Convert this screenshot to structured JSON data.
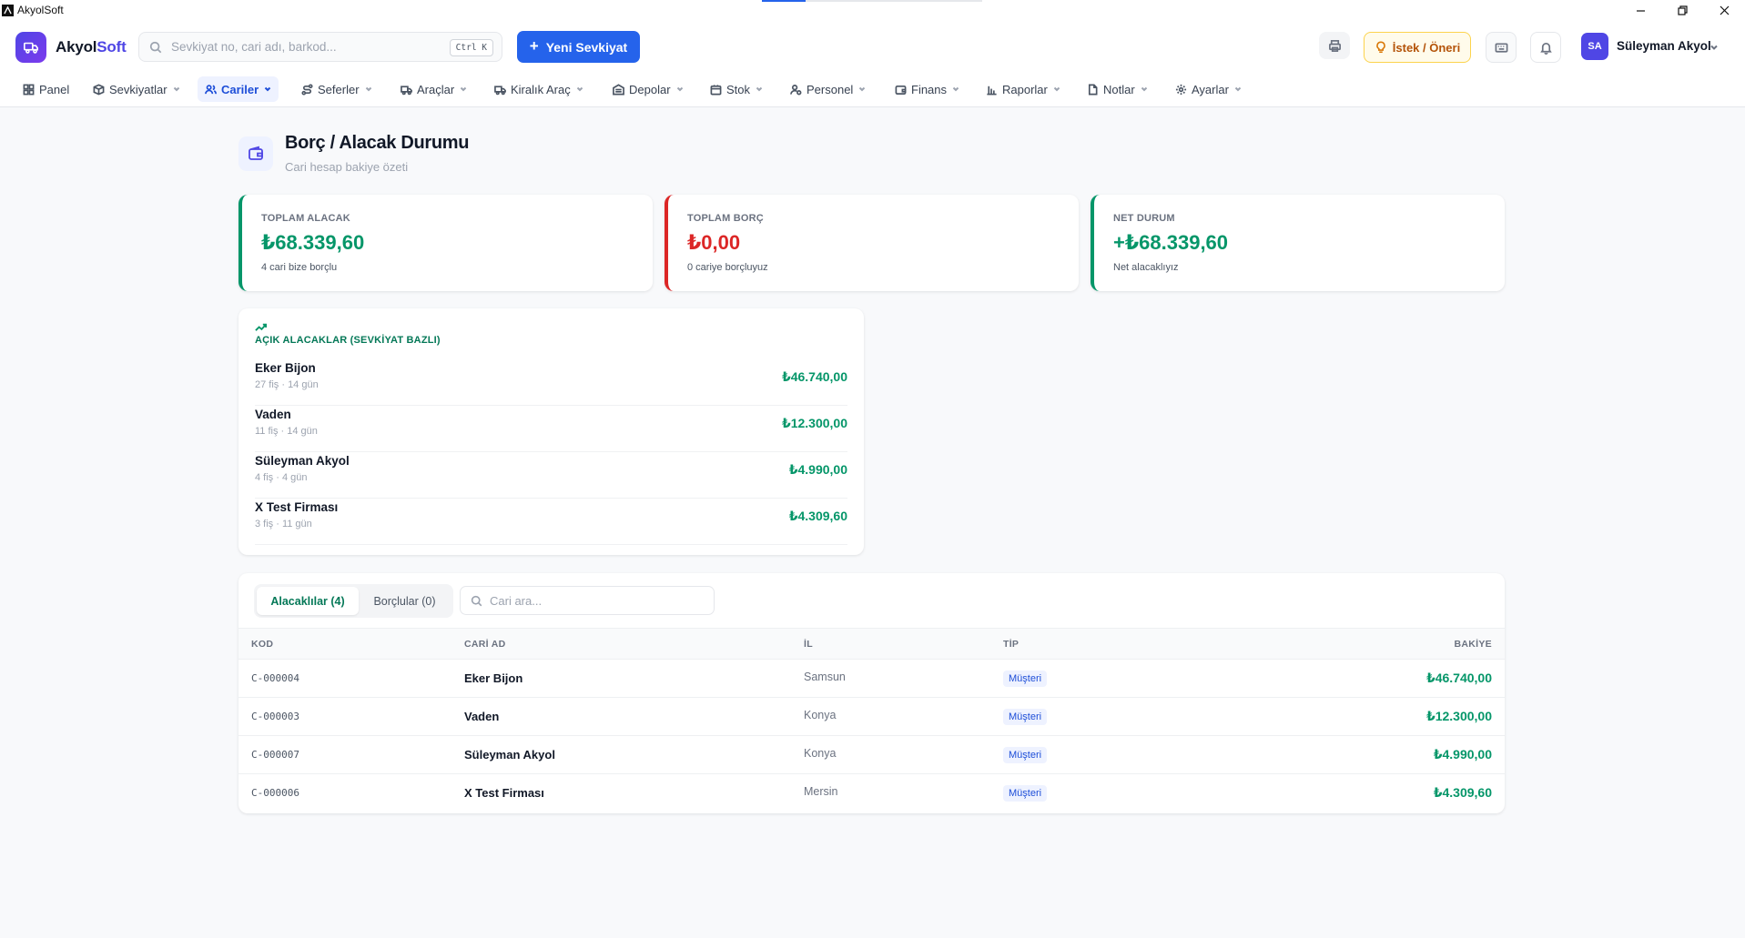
{
  "window": {
    "title": "AkyolSoft"
  },
  "header": {
    "brand_main": "Akyol",
    "brand_accent": "Soft",
    "search_placeholder": "Sevkiyat no, cari adı, barkod...",
    "search_shortcut": "Ctrl K",
    "new_button": "Yeni Sevkiyat",
    "suggest_button": "İstek / Öneri",
    "user_initials": "SA",
    "user_name": "Süleyman Akyol"
  },
  "nav": {
    "items": [
      {
        "label": "Panel",
        "icon": "grid-icon"
      },
      {
        "label": "Sevkiyatlar",
        "icon": "box-icon"
      },
      {
        "label": "Cariler",
        "icon": "users-icon",
        "active": true
      },
      {
        "label": "Seferler",
        "icon": "route-icon"
      },
      {
        "label": "Araçlar",
        "icon": "truck-icon"
      },
      {
        "label": "Kiralık Araç",
        "icon": "truck-icon"
      },
      {
        "label": "Depolar",
        "icon": "warehouse-icon"
      },
      {
        "label": "Stok",
        "icon": "package-icon"
      },
      {
        "label": "Personel",
        "icon": "user-cog-icon"
      },
      {
        "label": "Finans",
        "icon": "wallet-icon"
      },
      {
        "label": "Raporlar",
        "icon": "bar-chart-icon"
      },
      {
        "label": "Notlar",
        "icon": "file-icon"
      },
      {
        "label": "Ayarlar",
        "icon": "gear-icon"
      }
    ]
  },
  "page": {
    "title": "Borç / Alacak Durumu",
    "subtitle": "Cari hesap bakiye özeti"
  },
  "summary": [
    {
      "label": "TOPLAM ALACAK",
      "value": "₺68.339,60",
      "note": "4 cari bize borçlu",
      "color": "#059669"
    },
    {
      "label": "TOPLAM BORÇ",
      "value": "₺0,00",
      "note": "0 cariye borçluyuz",
      "color": "#dc2626"
    },
    {
      "label": "NET DURUM",
      "value": "+₺68.339,60",
      "note": "Net alacaklıyız",
      "color": "#059669"
    }
  ],
  "open_receivables": {
    "title": "AÇIK ALACAKLAR (SEVKİYAT BAZLI)",
    "items": [
      {
        "name": "Eker Bijon",
        "meta": "27 fiş · 14 gün",
        "amount": "₺46.740,00"
      },
      {
        "name": "Vaden",
        "meta": "11 fiş · 14 gün",
        "amount": "₺12.300,00"
      },
      {
        "name": "Süleyman Akyol",
        "meta": "4 fiş · 4 gün",
        "amount": "₺4.990,00"
      },
      {
        "name": "X Test Firması",
        "meta": "3 fiş · 11 gün",
        "amount": "₺4.309,60"
      }
    ]
  },
  "table": {
    "tabs": [
      "Alacaklılar (4)",
      "Borçlular (0)"
    ],
    "search_placeholder": "Cari ara...",
    "columns": [
      "KOD",
      "CARİ AD",
      "İL",
      "TİP",
      "BAKİYE"
    ],
    "rows": [
      {
        "code": "C-000004",
        "name": "Eker Bijon",
        "city": "Samsun",
        "type": "Müşteri",
        "balance": "₺46.740,00"
      },
      {
        "code": "C-000003",
        "name": "Vaden",
        "city": "Konya",
        "type": "Müşteri",
        "balance": "₺12.300,00"
      },
      {
        "code": "C-000007",
        "name": "Süleyman Akyol",
        "city": "Konya",
        "type": "Müşteri",
        "balance": "₺4.990,00"
      },
      {
        "code": "C-000006",
        "name": "X Test Firması",
        "city": "Mersin",
        "type": "Müşteri",
        "balance": "₺4.309,60"
      }
    ]
  },
  "colors": {
    "primary": "#2563eb",
    "brand": "#4f46e5",
    "positive": "#059669",
    "negative": "#dc2626"
  }
}
